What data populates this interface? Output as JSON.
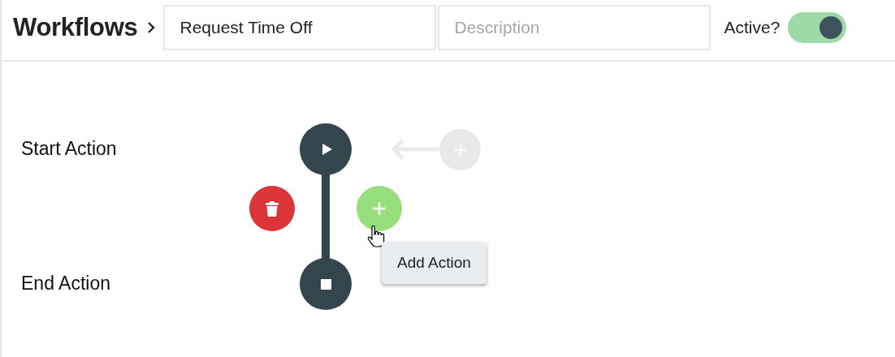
{
  "header": {
    "title": "Workflows",
    "name_field": {
      "value": "Request Time Off"
    },
    "description_field": {
      "placeholder": "Description"
    },
    "active": {
      "label": "Active?",
      "on": true
    }
  },
  "canvas": {
    "start_label": "Start Action",
    "end_label": "End Action",
    "tooltip": "Add Action"
  }
}
